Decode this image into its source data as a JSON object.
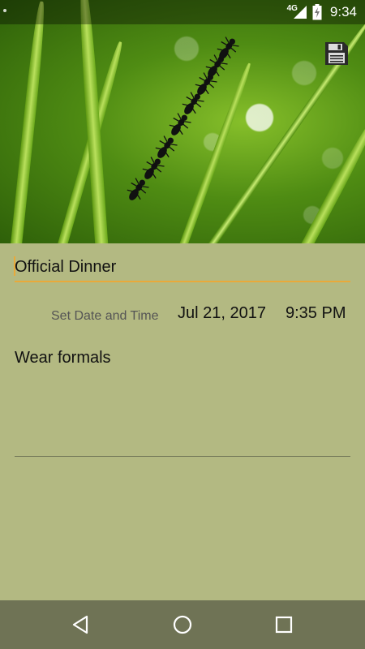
{
  "status_bar": {
    "network_label": "4G",
    "time": "9:34"
  },
  "header": {
    "save_icon": "floppy-disk-save-icon"
  },
  "form": {
    "title_value": "Official Dinner",
    "datetime_label": "Set Date and Time",
    "date": "Jul 21, 2017",
    "time": "9:35 PM",
    "notes_value": "Wear formals"
  },
  "nav": {
    "back_icon": "back-triangle-icon",
    "home_icon": "home-circle-icon",
    "recents_icon": "recents-square-icon"
  },
  "colors": {
    "background": "#b3b982",
    "accent_underline": "#e9a93a",
    "navbar": "#6f7355"
  }
}
